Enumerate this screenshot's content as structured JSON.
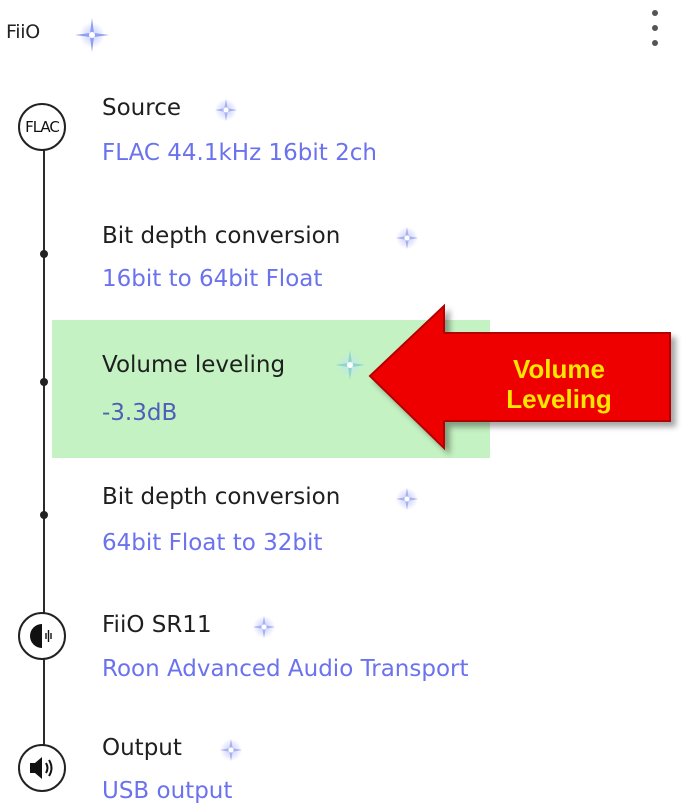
{
  "header": {
    "title": "FiiO"
  },
  "steps": [
    {
      "title": "Source",
      "value": "FLAC 44.1kHz 16bit 2ch",
      "node_label": "FLAC"
    },
    {
      "title": "Bit depth conversion",
      "value": "16bit to 64bit Float"
    },
    {
      "title": "Volume leveling",
      "value": "-3.3dB"
    },
    {
      "title": "Bit depth conversion",
      "value": "64bit Float to 32bit"
    },
    {
      "title": "FiiO SR11",
      "value": "Roon Advanced Audio Transport"
    },
    {
      "title": "Output",
      "value": "USB output"
    }
  ],
  "annotation": {
    "line1": "Volume",
    "line2": "Leveling"
  },
  "icons": {
    "quality": "sparkle-icon",
    "menu": "more-vertical-icon",
    "device": "speaker-wave-icon",
    "output": "volume-icon"
  },
  "colors": {
    "value_text": "#6a72ee",
    "highlight": "#c4f2c2",
    "callout_arrow": "#ee0000",
    "callout_text": "#ffe600"
  }
}
